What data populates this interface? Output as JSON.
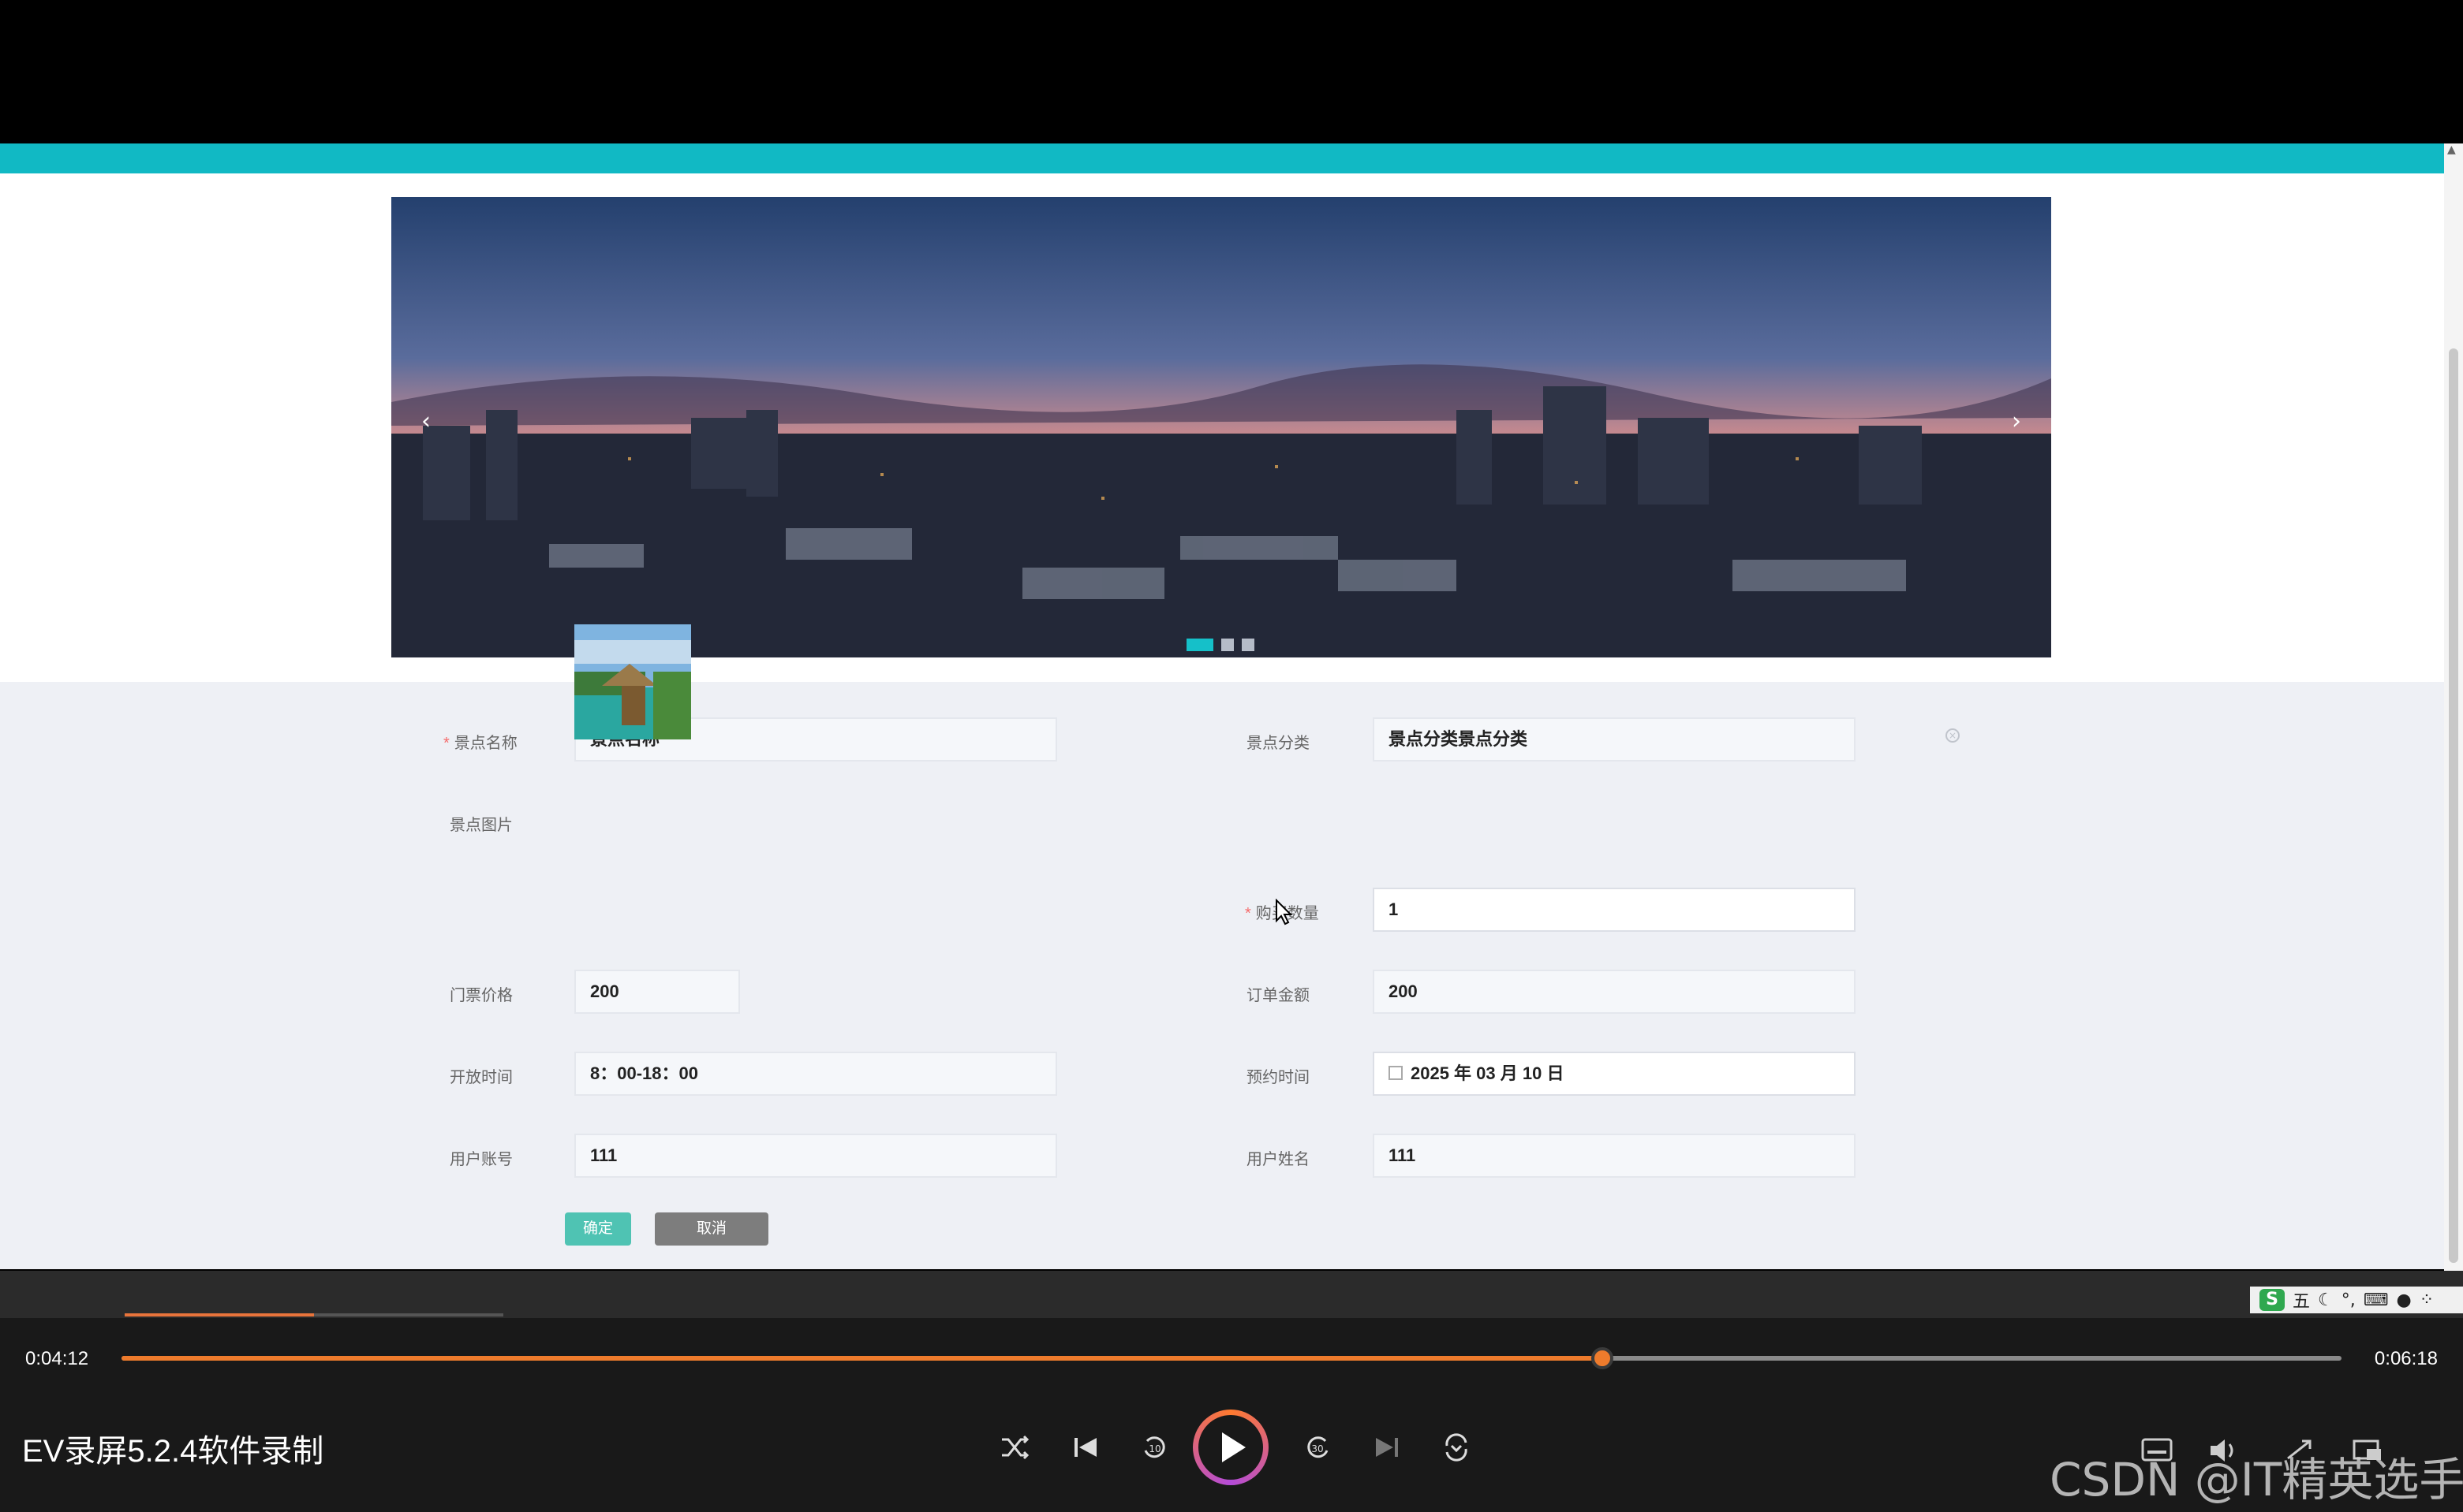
{
  "carousel": {
    "prev_icon": "‹",
    "next_icon": "›",
    "dots": [
      {
        "active": true
      },
      {
        "active": false
      },
      {
        "active": false
      }
    ]
  },
  "form": {
    "spot_name": {
      "label": "景点名称",
      "required_mark": "*",
      "value": "景点名称"
    },
    "spot_category": {
      "label": "景点分类",
      "value": "景点分类景点分类"
    },
    "spot_image": {
      "label": "景点图片"
    },
    "quantity": {
      "label": "购买数量",
      "required_mark": "*",
      "value": "1"
    },
    "ticket_price": {
      "label": "门票价格",
      "value": "200"
    },
    "order_amount": {
      "label": "订单金额",
      "value": "200"
    },
    "open_time": {
      "label": "开放时间",
      "value": "8：00-18：00"
    },
    "booking_time": {
      "label": "预约时间",
      "value": "2025 年 03 月 10 日"
    },
    "user_account": {
      "label": "用户账号",
      "value": "111"
    },
    "user_name": {
      "label": "用户姓名",
      "value": "111"
    },
    "confirm_label": "确定",
    "cancel_label": "取消"
  },
  "ime": {
    "logo": "S",
    "mode": "五"
  },
  "player": {
    "current_time": "0:04:12",
    "total_time": "0:06:18",
    "progress": 0.667,
    "title": "EV录屏5.2.4软件录制",
    "watermark": "CSDN @IT精英选手",
    "colors": {
      "accent": "#ee7b2c",
      "teal": "#11b9c4"
    }
  }
}
